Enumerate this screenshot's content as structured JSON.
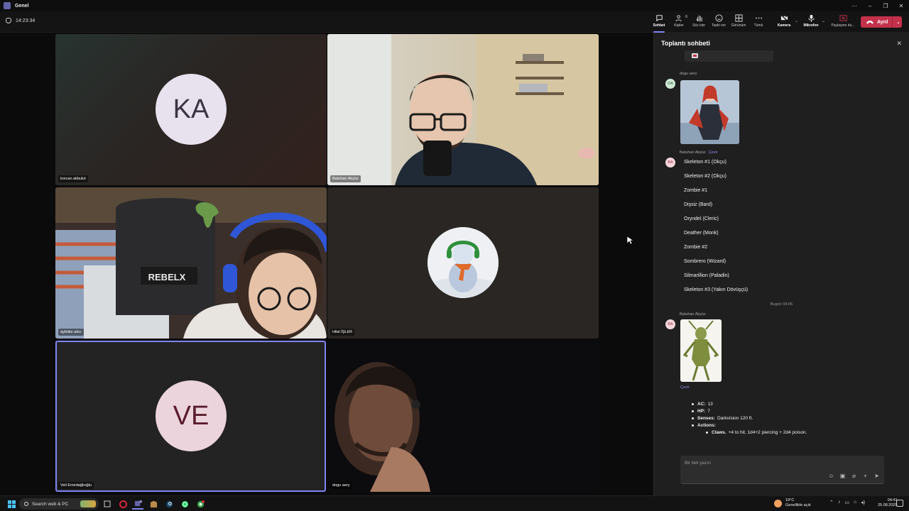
{
  "window": {
    "title": "Genel"
  },
  "toolbar": {
    "timer": "14:23:34",
    "buttons": [
      {
        "id": "chat",
        "label": "Sohbet",
        "active": true
      },
      {
        "id": "people",
        "label": "Kişiler",
        "count": "6"
      },
      {
        "id": "raise",
        "label": "Söz iste"
      },
      {
        "id": "react",
        "label": "Tepki ver"
      },
      {
        "id": "view",
        "label": "Görünüm"
      },
      {
        "id": "more",
        "label": "Tümü"
      },
      {
        "id": "camera",
        "label": "Kamera"
      },
      {
        "id": "mic",
        "label": "Mikrofon"
      },
      {
        "id": "share",
        "label": "Paylaşımı du..."
      }
    ],
    "leave_label": "Ayrıl"
  },
  "tiles": [
    {
      "name": "korcan akbulut",
      "initials": "KA",
      "avatar_bg": "#e8e1ee",
      "avatar_fg": "#3b3344"
    },
    {
      "name": "Batuhan Akyüz"
    },
    {
      "name": "aybüke atıcı"
    },
    {
      "name": "Hilal İŞLER"
    },
    {
      "name": "Veli Emirdağlıoğlu",
      "initials": "VE",
      "avatar_bg": "#ecd4dc",
      "avatar_fg": "#5a1d2e"
    },
    {
      "name": "dogu aery"
    }
  ],
  "chat": {
    "title": "Toplantı sohbeti",
    "msg1": {
      "sender": "dogu aery",
      "avatar": "DA"
    },
    "msg2": {
      "sender": "Batuhan Akyüz",
      "translate": "Çevir",
      "avatar": "BA",
      "items": [
        "Skeleton #1 (Okçu)",
        "Skeleton #2 (Okçu)",
        "Zombie #1",
        "Dişsiz (Bard)",
        "Oryndel (Cleric)",
        "Deather (Monk)",
        "Zombie #2",
        "Sombrero (Wizard)",
        "Silmarillion (Paladin)",
        "Skeleton #3 (Yakın Dövüşçü)"
      ]
    },
    "day_divider": "Bugün 04:05",
    "msg3": {
      "sender": "Batuhan Akyüz",
      "avatar": "BA",
      "translate": "Çevir",
      "ac_label": "AC:",
      "ac_value": "13",
      "hp_label": "HP:",
      "hp_value": "7",
      "senses_label": "Senses:",
      "senses_value": "Darkvision 120 ft.",
      "actions_label": "Actions:",
      "claws_label": "Claws.",
      "claws_value": "+4 to hit, 1d4+2 piercing + 2d4 poison."
    },
    "compose_placeholder": "Bir ileti yazın"
  },
  "taskbar": {
    "search_placeholder": "Search web & PC",
    "weather_temp": "19°C",
    "weather_desc": "Genellikle açık",
    "time": "04:41",
    "date": "25.08.2025"
  },
  "colors": {
    "accent": "#7f85f5",
    "leave": "#c4314b",
    "brand": "#6264a7"
  }
}
